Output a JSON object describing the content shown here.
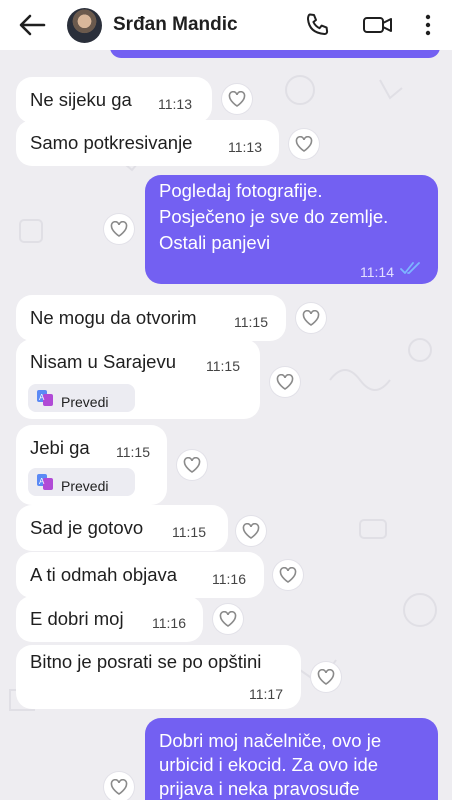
{
  "header": {
    "contact_name": "Srđan Mandic"
  },
  "colors": {
    "outgoing_bubble": "#7360f2",
    "incoming_bubble": "#ffffff",
    "read_ticks": "#7db5ff",
    "background": "#eeedf1"
  },
  "translate_label": "Prevedi",
  "messages": [
    {
      "direction": "in",
      "text": "Ne sijeku ga",
      "time": "11:13"
    },
    {
      "direction": "in",
      "text": "Samo potkresivanje",
      "time": "11:13"
    },
    {
      "direction": "out",
      "lines": [
        "Pogledaj fotografije.",
        "Posječeno je sve do zemlje.",
        "Ostali panjevi"
      ],
      "time": "11:14",
      "status": "read"
    },
    {
      "direction": "in",
      "text": "Ne mogu da otvorim",
      "time": "11:15"
    },
    {
      "direction": "in",
      "text": "Nisam u Sarajevu",
      "time": "11:15",
      "translate": true
    },
    {
      "direction": "in",
      "text": "Jebi ga",
      "time": "11:15",
      "translate": true
    },
    {
      "direction": "in",
      "text": "Sad je gotovo",
      "time": "11:15"
    },
    {
      "direction": "in",
      "text": "A ti odmah objava",
      "time": "11:16"
    },
    {
      "direction": "in",
      "text": "E dobri moj",
      "time": "11:16"
    },
    {
      "direction": "in",
      "text": "Bitno je posrati se po opštini",
      "time": "11:17"
    },
    {
      "direction": "out",
      "lines": [
        "Dobri moj načelniče, ovo je",
        "urbicid i ekocid. Za ovo ide",
        "prijava i neka pravosuđe"
      ]
    }
  ]
}
